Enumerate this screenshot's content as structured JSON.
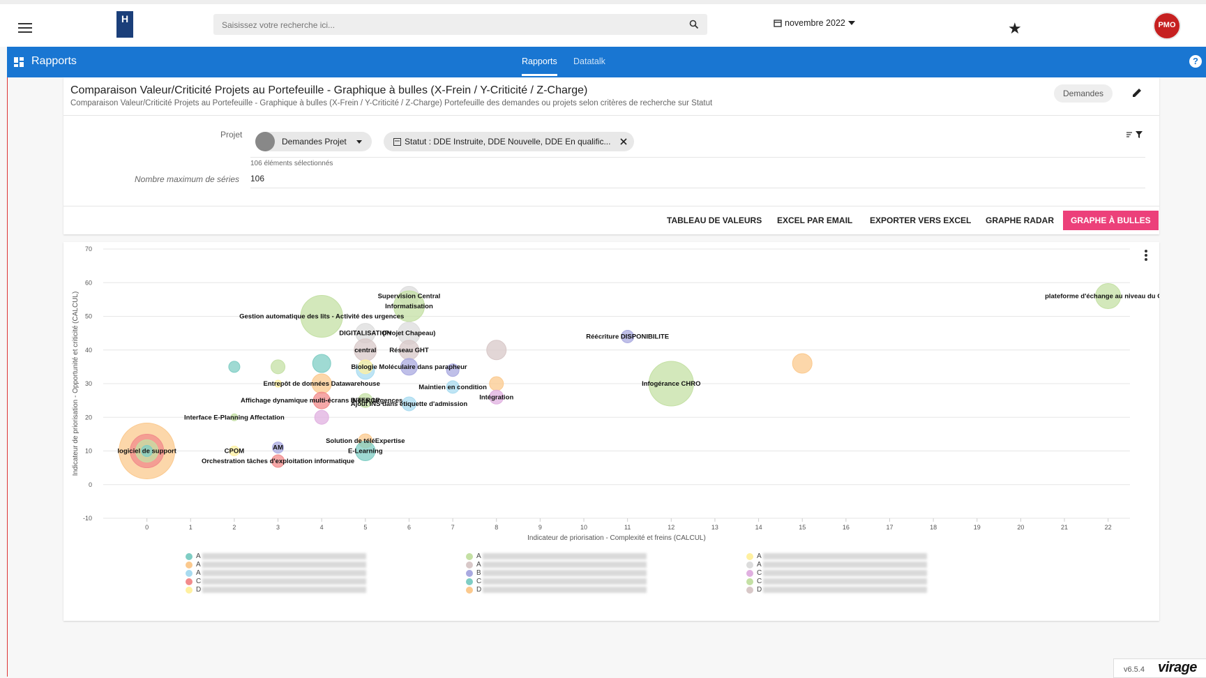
{
  "topbar": {
    "search_placeholder": "Saisissez votre recherche ici...",
    "date": "novembre 2022",
    "avatar_text": "PMO",
    "logo_text": "H"
  },
  "navbar": {
    "title": "Rapports",
    "tabs": [
      "Rapports",
      "Datatalk"
    ],
    "help": "?"
  },
  "report": {
    "title": "Comparaison Valeur/Criticité Projets au Portefeuille - Graphique à bulles (X-Frein / Y-Criticité / Z-Charge)",
    "subtitle": "Comparaison Valeur/Criticité Projets au Portefeuille - Graphique à bulles (X-Frein / Y-Criticité / Z-Charge) Portefeuille des demandes ou projets selon critères de recherche sur Statut",
    "badge": "Demandes",
    "filters": {
      "projet_label": "Projet",
      "projet_chip": "Demandes Projet",
      "statut_chip": "Statut : DDE Instruite, DDE Nouvelle, DDE En qualific...",
      "selected_count": "106 éléments sélectionnés",
      "max_series_label": "Nombre maximum de séries",
      "max_series_value": "106"
    },
    "actions": [
      "TABLEAU DE VALEURS",
      "EXCEL PAR EMAIL",
      "EXPORTER VERS EXCEL",
      "GRAPHE RADAR",
      "GRAPHE À BULLES"
    ]
  },
  "footer": {
    "version": "v6.5.4",
    "brand": "virage"
  },
  "legend": {
    "col1": [
      {
        "l": "A",
        "c": "#7fcdc4"
      },
      {
        "l": "A",
        "c": "#fbc98e"
      },
      {
        "l": "A",
        "c": "#a8dbf0"
      },
      {
        "l": "C",
        "c": "#f28b8b"
      },
      {
        "l": "D",
        "c": "#fff0a0"
      }
    ],
    "col2": [
      {
        "l": "A",
        "c": "#c4e0a4"
      },
      {
        "l": "A",
        "c": "#d8c8c8"
      },
      {
        "l": "B",
        "c": "#a9a9e0"
      },
      {
        "l": "C",
        "c": "#7fcdc4"
      },
      {
        "l": "D",
        "c": "#fbc98e"
      }
    ],
    "col3": [
      {
        "l": "A",
        "c": "#fff0a0"
      },
      {
        "l": "A",
        "c": "#dcdcdc"
      },
      {
        "l": "C",
        "c": "#e0b0e0"
      },
      {
        "l": "C",
        "c": "#c4e0a4"
      },
      {
        "l": "D",
        "c": "#d8c8c8"
      }
    ]
  },
  "chart_data": {
    "type": "scatter",
    "xlabel": "Indicateur de priorisation - Complexité et freins (CALCUL)",
    "ylabel": "Indicateur de priorisation - Opportunité et criticité (CALCUL)",
    "xlim": [
      -1,
      22.5
    ],
    "ylim": [
      -10,
      70
    ],
    "xticks": [
      0,
      1,
      2,
      3,
      4,
      5,
      6,
      7,
      8,
      9,
      10,
      11,
      12,
      13,
      14,
      15,
      16,
      17,
      18,
      19,
      20,
      21,
      22
    ],
    "yticks": [
      -10,
      0,
      10,
      20,
      30,
      40,
      50,
      60,
      70
    ],
    "grid": true,
    "points": [
      {
        "x": 0,
        "y": 10,
        "r": 40,
        "c": "#fbc98e",
        "label": ""
      },
      {
        "x": 0,
        "y": 10,
        "r": 24,
        "c": "#f28b8b",
        "label": ""
      },
      {
        "x": 0,
        "y": 10,
        "r": 16,
        "c": "#c4e0a4",
        "label": "logiciel de support"
      },
      {
        "x": 0,
        "y": 10,
        "r": 8,
        "c": "#7fcdc4",
        "label": ""
      },
      {
        "x": 2,
        "y": 35,
        "r": 8,
        "c": "#7fcdc4",
        "label": ""
      },
      {
        "x": 2,
        "y": 10,
        "r": 7,
        "c": "#fff0a0",
        "label": "CPOM"
      },
      {
        "x": 2,
        "y": 20,
        "r": 5,
        "c": "#c4e0a4",
        "label": "Interface E-Planning Affectation"
      },
      {
        "x": 3,
        "y": 35,
        "r": 10,
        "c": "#c4e0a4",
        "label": ""
      },
      {
        "x": 3,
        "y": 11,
        "r": 8,
        "c": "#a9a9e0",
        "label": "AM"
      },
      {
        "x": 3,
        "y": 7,
        "r": 9,
        "c": "#f28b8b",
        "label": "Orchestration tâches d'exploitation informatique"
      },
      {
        "x": 3,
        "y": 30,
        "r": 5,
        "c": "#fff0a0",
        "label": ""
      },
      {
        "x": 4,
        "y": 50,
        "r": 30,
        "c": "#c4e0a4",
        "label": "Gestion automatique des lits - Activité des urgences"
      },
      {
        "x": 4,
        "y": 36,
        "r": 13,
        "c": "#7fcdc4",
        "label": ""
      },
      {
        "x": 4,
        "y": 30,
        "r": 14,
        "c": "#fbc98e",
        "label": "Entrepôt de données Datawarehouse"
      },
      {
        "x": 4,
        "y": 25,
        "r": 12,
        "c": "#f28b8b",
        "label": "Affichage dynamique multi-écrans Blocs, Urgences"
      },
      {
        "x": 4,
        "y": 20,
        "r": 10,
        "c": "#e0b0e0",
        "label": ""
      },
      {
        "x": 5,
        "y": 45,
        "r": 14,
        "c": "#dcdcdc",
        "label": "DIGITALISATION"
      },
      {
        "x": 5,
        "y": 40,
        "r": 16,
        "c": "#d8c8c8",
        "label": "central"
      },
      {
        "x": 5,
        "y": 34,
        "r": 13,
        "c": "#a8dbf0",
        "label": ""
      },
      {
        "x": 5,
        "y": 35,
        "r": 10,
        "c": "#fff0a0",
        "label": ""
      },
      {
        "x": 5,
        "y": 25,
        "r": 10,
        "c": "#c4e0a4",
        "label": "INTEROP"
      },
      {
        "x": 5,
        "y": 13,
        "r": 10,
        "c": "#fbc98e",
        "label": "Solution de téléExpertise"
      },
      {
        "x": 5,
        "y": 10,
        "r": 14,
        "c": "#7fcdc4",
        "label": "E-Learning"
      },
      {
        "x": 6,
        "y": 56,
        "r": 14,
        "c": "#dcdcdc",
        "label": "Supervision Central"
      },
      {
        "x": 6,
        "y": 53,
        "r": 22,
        "c": "#c4e0a4",
        "label": "Informatisation"
      },
      {
        "x": 6,
        "y": 45,
        "r": 16,
        "c": "#dcdcdc",
        "label": "(Projet Chapeau)"
      },
      {
        "x": 6,
        "y": 40,
        "r": 14,
        "c": "#d8c8c8",
        "label": "Réseau GHT"
      },
      {
        "x": 6,
        "y": 35,
        "r": 12,
        "c": "#a9a9e0",
        "label": "Biologie Moléculaire dans parapheur"
      },
      {
        "x": 6,
        "y": 24,
        "r": 10,
        "c": "#a8dbf0",
        "label": "Ajout INS dans étiquette d'admission"
      },
      {
        "x": 7,
        "y": 34,
        "r": 9,
        "c": "#a9a9e0",
        "label": ""
      },
      {
        "x": 7,
        "y": 29,
        "r": 9,
        "c": "#a8dbf0",
        "label": "Maintien en condition"
      },
      {
        "x": 8,
        "y": 40,
        "r": 14,
        "c": "#d8c8c8",
        "label": ""
      },
      {
        "x": 8,
        "y": 30,
        "r": 10,
        "c": "#fbc98e",
        "label": ""
      },
      {
        "x": 8,
        "y": 26,
        "r": 10,
        "c": "#e0b0e0",
        "label": "Intégration"
      },
      {
        "x": 11,
        "y": 44,
        "r": 9,
        "c": "#a9a9e0",
        "label": "Réécriture DISPONIBILITE"
      },
      {
        "x": 12,
        "y": 30,
        "r": 32,
        "c": "#c4e0a4",
        "label": "Infogérance CHRO"
      },
      {
        "x": 15,
        "y": 36,
        "r": 14,
        "c": "#fbc98e",
        "label": ""
      },
      {
        "x": 22,
        "y": 56,
        "r": 18,
        "c": "#c4e0a4",
        "label": "plateforme d'échange au niveau du GHT"
      }
    ]
  }
}
